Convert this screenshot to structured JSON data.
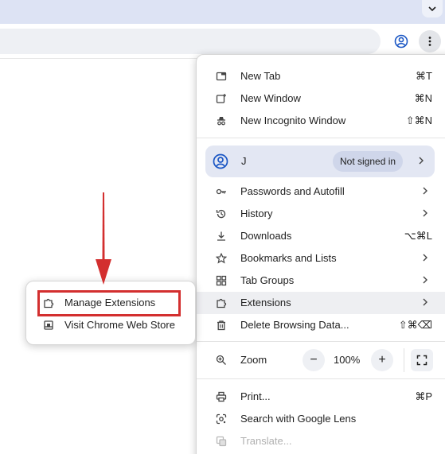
{
  "menu": {
    "items_top": [
      {
        "label": "New Tab",
        "shortcut": "⌘T",
        "icon": "new-tab-icon"
      },
      {
        "label": "New Window",
        "shortcut": "⌘N",
        "icon": "new-window-icon"
      },
      {
        "label": "New Incognito Window",
        "shortcut": "⇧⌘N",
        "icon": "incognito-icon"
      }
    ],
    "profile": {
      "name": "J",
      "status": "Not signed in"
    },
    "items_mid": [
      {
        "label": "Passwords and Autofill",
        "icon": "key-icon"
      },
      {
        "label": "History",
        "icon": "history-icon"
      },
      {
        "label": "Downloads",
        "shortcut": "⌥⌘L",
        "icon": "download-icon"
      },
      {
        "label": "Bookmarks and Lists",
        "icon": "star-icon"
      },
      {
        "label": "Tab Groups",
        "icon": "tab-groups-icon"
      },
      {
        "label": "Extensions",
        "icon": "extension-icon"
      },
      {
        "label": "Delete Browsing Data...",
        "shortcut": "⇧⌘⌫",
        "icon": "trash-icon"
      }
    ],
    "zoom": {
      "label": "Zoom",
      "value": "100%",
      "minus": "−",
      "plus": "+"
    },
    "items_bottom": [
      {
        "label": "Print...",
        "shortcut": "⌘P",
        "icon": "print-icon"
      },
      {
        "label": "Search with Google Lens",
        "icon": "lens-icon"
      },
      {
        "label": "Translate...",
        "icon": "translate-icon"
      }
    ]
  },
  "submenu": {
    "items": [
      {
        "label": "Manage Extensions",
        "icon": "extension-icon"
      },
      {
        "label": "Visit Chrome Web Store",
        "icon": "web-store-icon"
      }
    ]
  },
  "colors": {
    "annotation": "#d32f2f",
    "accent": "#1a56c4"
  }
}
